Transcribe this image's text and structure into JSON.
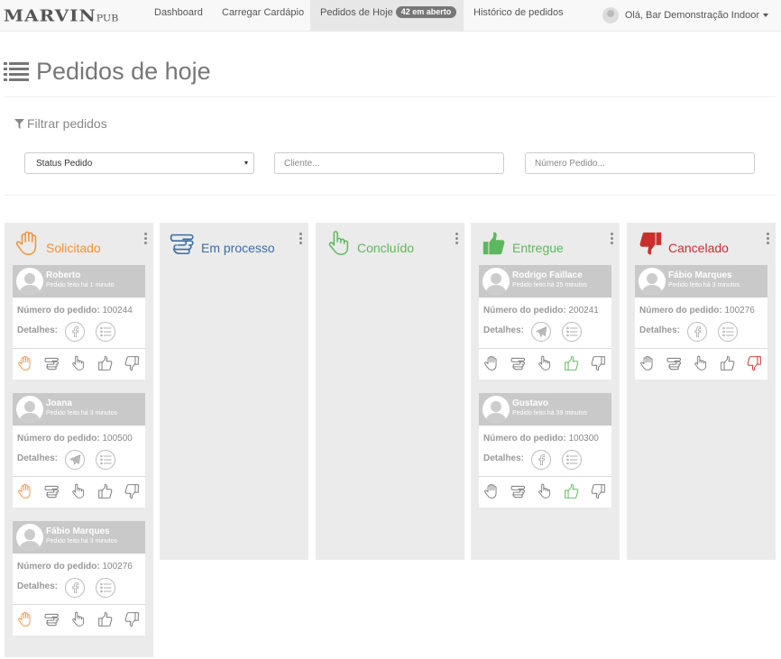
{
  "navbar": {
    "brand": "MARVIN",
    "brand_sub": "PUB",
    "items": [
      {
        "label": "Dashboard"
      },
      {
        "label": "Carregar Cardápio"
      },
      {
        "label": "Pedidos de Hoje",
        "badge": "42 em aberto",
        "active": true
      },
      {
        "label": "Histórico de pedidos"
      }
    ],
    "user": "Olá, Bar Demonstração Indoor"
  },
  "header": {
    "title": "Pedidos de hoje"
  },
  "filter": {
    "title": "Filtrar pedidos",
    "status_select": "Status Pedido",
    "client_placeholder": "Cliente...",
    "number_placeholder": "Número Pedido..."
  },
  "labels": {
    "order_number": "Número do pedido:",
    "details": "Detalhes:"
  },
  "colors": {
    "solicitado": "#f0913a",
    "em_processo": "#3a6ea5",
    "concluido": "#5cb85c",
    "entregue": "#5cb85c",
    "cancelado": "#c9302c",
    "action_gray": "#777"
  },
  "columns": [
    {
      "key": "solicitado",
      "title": "Solicitado",
      "icon": "hand-stop-icon",
      "orders": [
        {
          "name": "Roberto",
          "time": "Pedido feito há 1 minuto",
          "number": "100244",
          "channel": "facebook-icon",
          "active_action": "hand"
        },
        {
          "name": "Joana",
          "time": "Pedido feito há 3 minutos",
          "number": "100500",
          "channel": "paper-plane-icon",
          "active_action": "hand"
        },
        {
          "name": "Fábio Marques",
          "time": "Pedido feito há 3 minutos",
          "number": "100276",
          "channel": "facebook-icon",
          "active_action": "hand"
        }
      ]
    },
    {
      "key": "em_processo",
      "title": "Em processo",
      "icon": "hand-pointing-icon",
      "orders": []
    },
    {
      "key": "concluido",
      "title": "Concluído",
      "icon": "hand-pointer-icon",
      "orders": []
    },
    {
      "key": "entregue",
      "title": "Entregue",
      "icon": "thumbs-up-icon",
      "orders": [
        {
          "name": "Rodrigo Faillace",
          "time": "Pedido feito há 25 minutos",
          "number": "200241",
          "channel": "paper-plane-icon",
          "active_action": "up"
        },
        {
          "name": "Gustavo",
          "time": "Pedido feito há 39 minutos",
          "number": "100300",
          "channel": "facebook-icon",
          "active_action": "up"
        }
      ]
    },
    {
      "key": "cancelado",
      "title": "Cancelado",
      "icon": "thumbs-down-icon",
      "orders": [
        {
          "name": "Fábio Marques",
          "time": "Pedido feito há 3 minutos",
          "number": "100276",
          "channel": "facebook-icon",
          "active_action": "down"
        }
      ]
    }
  ]
}
